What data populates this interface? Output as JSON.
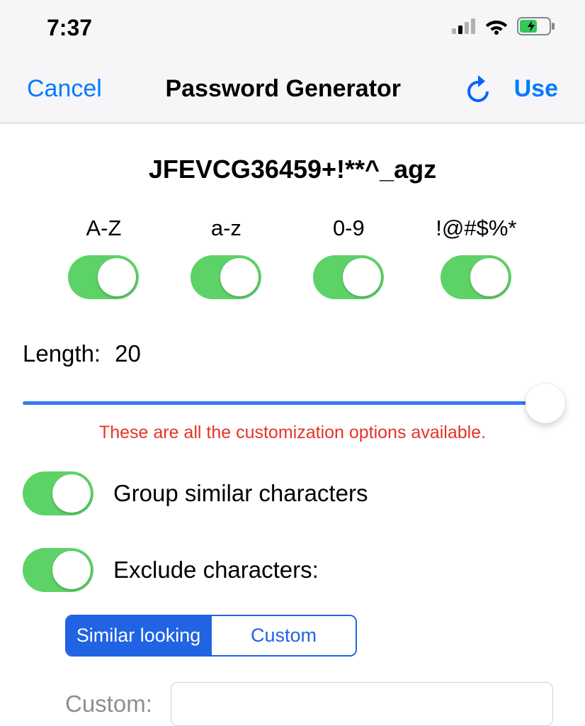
{
  "status": {
    "time": "7:37"
  },
  "nav": {
    "cancel": "Cancel",
    "title": "Password Generator",
    "use": "Use"
  },
  "generated_password": "JFEVCG36459+!**^_agz",
  "charsets": [
    {
      "label": "A-Z",
      "enabled": true
    },
    {
      "label": "a-z",
      "enabled": true
    },
    {
      "label": "0-9",
      "enabled": true
    },
    {
      "label": "!@#$%*",
      "enabled": true
    }
  ],
  "length": {
    "label": "Length:",
    "value": "20"
  },
  "note": "These are all the customization options available.",
  "options": {
    "group_similar": {
      "label": "Group similar characters",
      "enabled": true
    },
    "exclude": {
      "label": "Exclude characters:",
      "enabled": true
    }
  },
  "exclude_mode": {
    "segments": [
      "Similar looking",
      "Custom"
    ],
    "active_index": 0
  },
  "custom": {
    "label": "Custom:",
    "value": "",
    "placeholder": ""
  }
}
